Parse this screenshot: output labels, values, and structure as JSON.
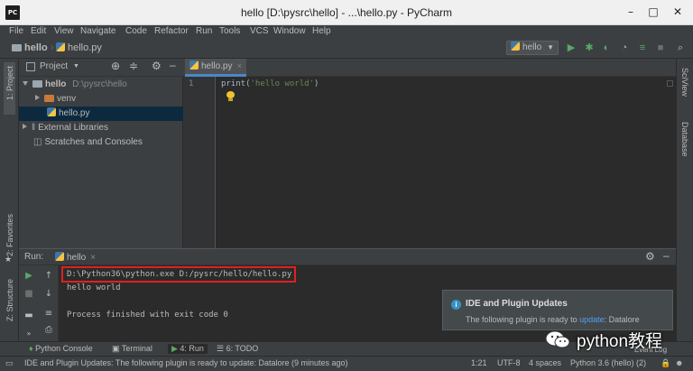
{
  "window": {
    "app_icon": "PC",
    "title": "hello [D:\\pysrc\\hello] - ...\\hello.py - PyCharm",
    "minimize": "–",
    "maximize": "□",
    "close": "✕"
  },
  "menu": {
    "items": [
      "File",
      "Edit",
      "View",
      "Navigate",
      "Code",
      "Refactor",
      "Run",
      "Tools",
      "VCS",
      "Window",
      "Help"
    ]
  },
  "navbar": {
    "project_crumb": "hello",
    "file_crumb": "hello.py",
    "run_config": "hello"
  },
  "left_strip": {
    "project_label": "1: Project",
    "favorites_label": "2: Favorites",
    "structure_label": "Z: Structure"
  },
  "right_strip": {
    "sciview_label": "SciView",
    "database_label": "Database"
  },
  "project_panel": {
    "header_label": "Project",
    "tree": {
      "root_name": "hello",
      "root_path": "D:\\pysrc\\hello",
      "venv": "venv",
      "file": "hello.py",
      "external_libraries": "External Libraries",
      "scratches": "Scratches and Consoles"
    }
  },
  "editor": {
    "tab_label": "hello.py",
    "line_number": "1",
    "code_func": "print",
    "code_open": "(",
    "code_string": "'hello world'",
    "code_close": ")"
  },
  "run_panel": {
    "label": "Run:",
    "tab_label": "hello",
    "command_line": "D:\\Python36\\python.exe D:/pysrc/hello/hello.py",
    "output_line": "hello world",
    "exit_line": "Process finished with exit code 0"
  },
  "notification": {
    "title": "IDE and Plugin Updates",
    "body_prefix": "The following plugin is ready to ",
    "body_link": "update",
    "body_suffix": ": Datalore"
  },
  "bottom_tabs": {
    "python_console": "Python Console",
    "terminal": "Terminal",
    "run": "4: Run",
    "todo": "6: TODO",
    "event_log": "Event Log"
  },
  "status_bar": {
    "message": "IDE and Plugin Updates: The following plugin is ready to update: Datalore (9 minutes ago)",
    "position": "1:21",
    "encoding": "UTF-8",
    "indent": "4 spaces",
    "interpreter": "Python 3.6 (hello) (2)"
  },
  "watermark": {
    "text": "python教程"
  },
  "colors": {
    "accent": "#4a88c7",
    "string": "#6a8759",
    "highlight_box": "#e02020",
    "run_green": "#59a869"
  }
}
